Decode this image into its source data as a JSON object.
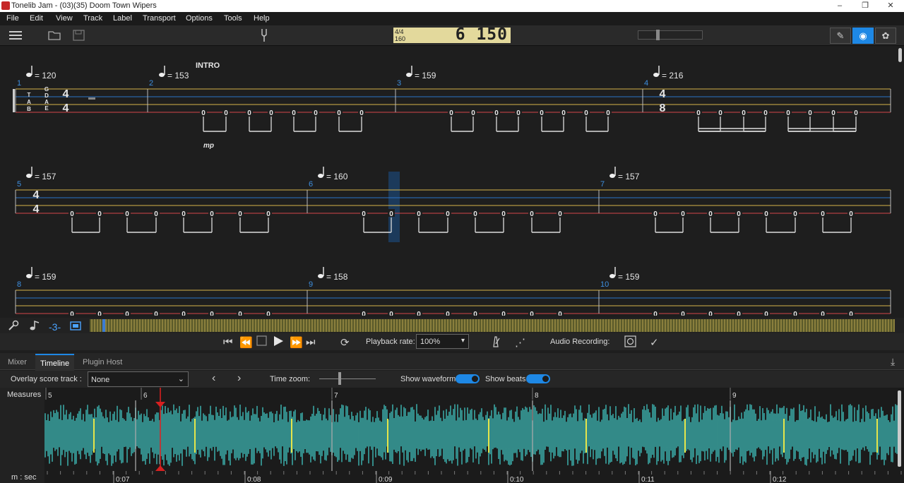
{
  "window": {
    "title": "Tonelib Jam - (03)(35) Doom Town  Wipers",
    "controls": [
      "–",
      "❐",
      "✕"
    ]
  },
  "menu": [
    "File",
    "Edit",
    "View",
    "Track",
    "Label",
    "Transport",
    "Options",
    "Tools",
    "Help"
  ],
  "toolbar": {
    "icons": [
      "menu-icon",
      "folder-open-icon",
      "save-icon",
      "tuning-fork-icon"
    ],
    "lcd": {
      "signature": "4/4",
      "tempo": "160",
      "position": "6 150"
    },
    "modes": [
      "pencil-icon",
      "eye-icon",
      "palette-icon"
    ],
    "active_mode": "eye-icon"
  },
  "score": {
    "systems": [
      {
        "measures": [
          {
            "number": "1",
            "tempo": "= 120",
            "time_sig": [
              "4",
              "4"
            ],
            "strings": [
              "G",
              "D",
              "A",
              "E"
            ]
          },
          {
            "number": "2",
            "tempo": "= 153",
            "section": "INTRO",
            "dynamic": "mp"
          },
          {
            "number": "3",
            "tempo": "= 159"
          },
          {
            "number": "4",
            "tempo": "= 216",
            "time_sig": [
              "4",
              "8"
            ]
          }
        ]
      },
      {
        "measures": [
          {
            "number": "5",
            "tempo": "= 157",
            "time_sig": [
              "4",
              "4"
            ]
          },
          {
            "number": "6",
            "tempo": "= 160"
          },
          {
            "number": "7",
            "tempo": "= 157"
          }
        ]
      },
      {
        "measures": [
          {
            "number": "8",
            "tempo": "= 159"
          },
          {
            "number": "9",
            "tempo": "= 158"
          },
          {
            "number": "10",
            "tempo": "= 159"
          }
        ]
      }
    ],
    "tab_label": [
      "T",
      "A",
      "B"
    ],
    "fret": "0"
  },
  "trackbar": {
    "icons": [
      "wrench-icon",
      "note-icon",
      "tab-3-icon",
      "video-icon"
    ],
    "tab3_label": "-3-"
  },
  "transport": {
    "playback_rate_label": "Playback rate:",
    "playback_rate": "100%",
    "audio_recording_label": "Audio Recording:"
  },
  "panel_tabs": {
    "items": [
      "Mixer",
      "Timeline",
      "Plugin Host"
    ],
    "active": "Timeline"
  },
  "timeline": {
    "overlay_label": "Overlay score track :",
    "overlay_value": "None",
    "time_zoom_label": "Time zoom:",
    "show_waveform_label": "Show waveform:",
    "show_waveform": true,
    "show_beats_label": "Show beats:",
    "show_beats": true,
    "measures_label": "Measures",
    "measure_numbers": [
      "5",
      "6",
      "7",
      "8",
      "9"
    ],
    "time_unit_label": "m : sec",
    "time_labels": [
      "0:07",
      "0:08",
      "0:09",
      "0:10",
      "0:11",
      "0:12"
    ],
    "colors": {
      "waveform": "#3aa7a4",
      "beat_marker": "#e5e54a",
      "playhead": "#d62020"
    }
  }
}
